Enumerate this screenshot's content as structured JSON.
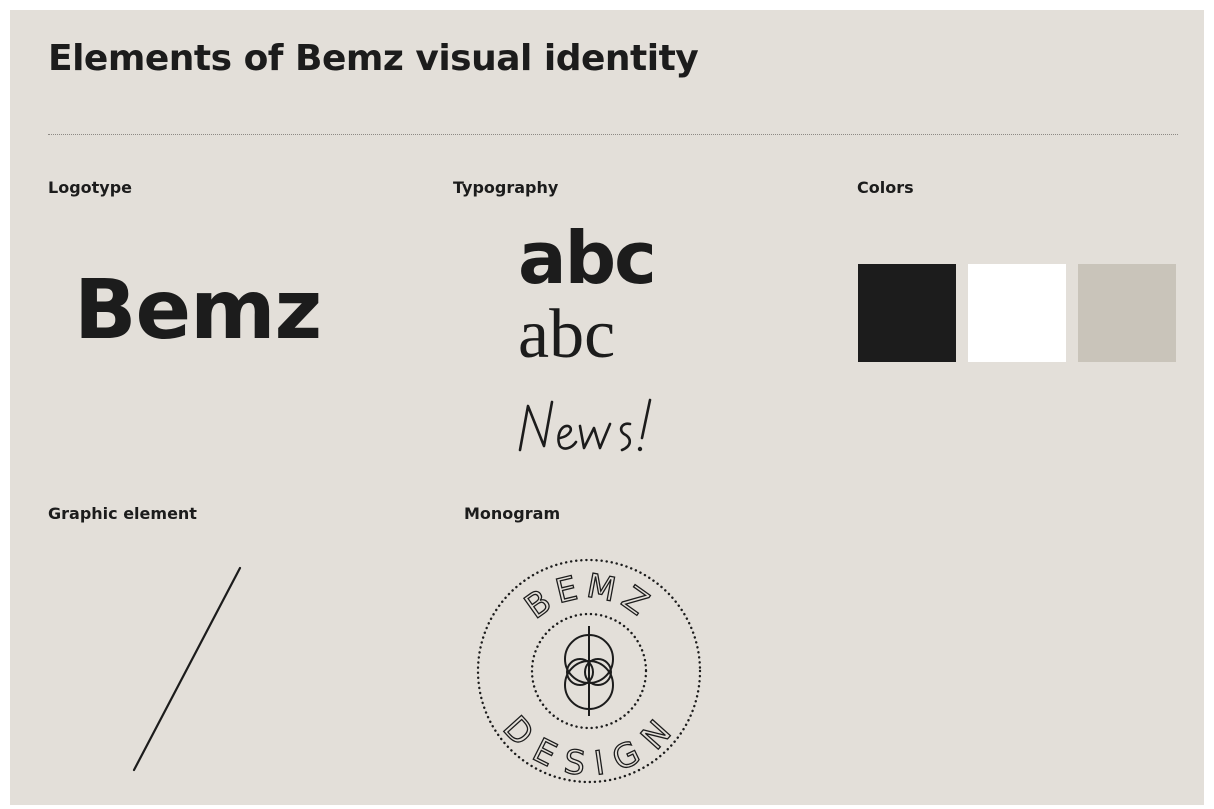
{
  "page": {
    "title": "Elements of Bemz visual identity"
  },
  "sections": {
    "logotype": {
      "label": "Logotype",
      "logo_text": "Bemz"
    },
    "typography": {
      "label": "Typography",
      "sans_sample": "abc",
      "serif_sample": "abc",
      "script_sample": "News!"
    },
    "colors": {
      "label": "Colors",
      "swatches": [
        "#1c1c1c",
        "#ffffff",
        "#c9c4ba"
      ]
    },
    "graphic_element": {
      "label": "Graphic element"
    },
    "monogram": {
      "label": "Monogram",
      "top_text": "BEMZ",
      "bottom_text": "DESIGN"
    }
  },
  "theme": {
    "background": "#e3dfd9",
    "ink": "#1c1c1c"
  }
}
